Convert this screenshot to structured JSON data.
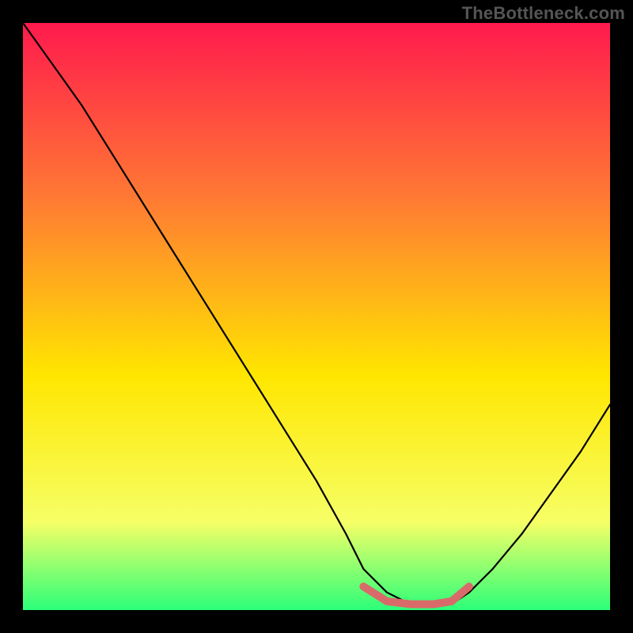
{
  "watermark": "TheBottleneck.com",
  "chart_data": {
    "type": "line",
    "title": "",
    "xlabel": "",
    "ylabel": "",
    "xlim": [
      0,
      100
    ],
    "ylim": [
      0,
      100
    ],
    "background_gradient": {
      "top": "#ff1a4d",
      "mid_upper": "#ff7a33",
      "mid": "#ffe600",
      "lower": "#f6ff66",
      "bottom": "#2cff79"
    },
    "series": [
      {
        "name": "curve",
        "color": "#000000",
        "x": [
          0,
          5,
          10,
          15,
          20,
          25,
          30,
          35,
          40,
          45,
          50,
          55,
          58,
          62,
          66,
          70,
          73,
          76,
          80,
          85,
          90,
          95,
          100
        ],
        "y": [
          100,
          93,
          86,
          78,
          70,
          62,
          54,
          46,
          38,
          30,
          22,
          13,
          7,
          3,
          1,
          1,
          1,
          3,
          7,
          13,
          20,
          27,
          35
        ]
      },
      {
        "name": "bottom-highlight",
        "color": "#d96a6a",
        "x": [
          58,
          62,
          66,
          70,
          73,
          76
        ],
        "y": [
          4,
          1.5,
          1,
          1,
          1.5,
          4
        ]
      }
    ]
  }
}
